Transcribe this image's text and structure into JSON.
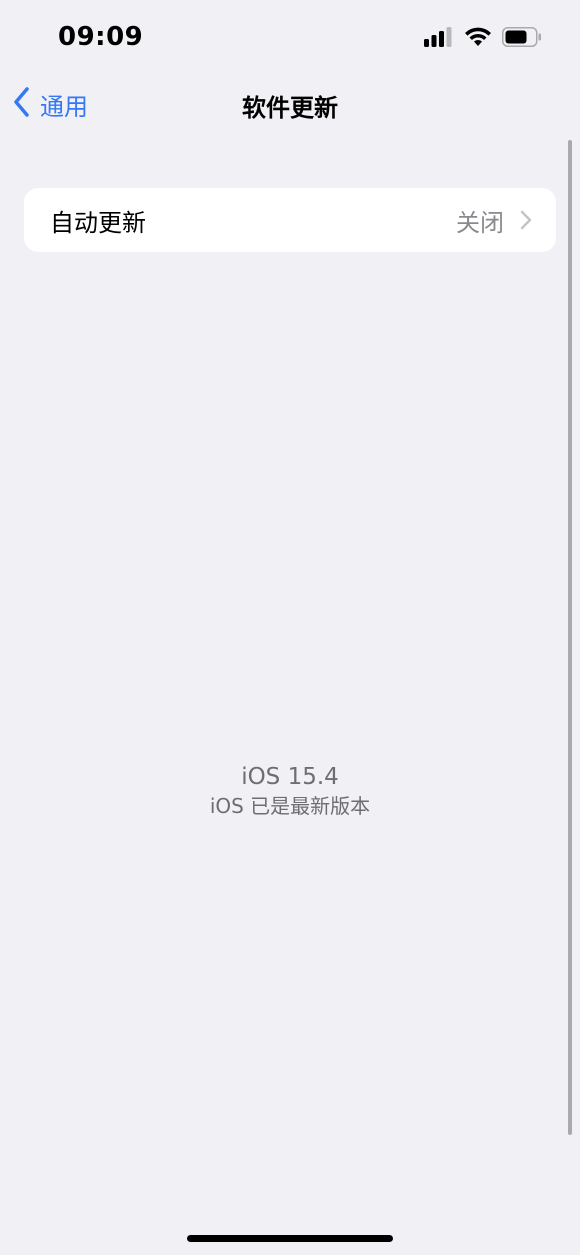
{
  "status_bar": {
    "time": "09:09"
  },
  "nav": {
    "back_label": "通用",
    "title": "软件更新"
  },
  "settings": {
    "auto_update": {
      "label": "自动更新",
      "value": "关闭"
    }
  },
  "version": {
    "name": "iOS 15.4",
    "status": "iOS 已是最新版本"
  },
  "colors": {
    "accent": "#3478f6",
    "background": "#f0f0f5",
    "secondary_text": "#8a8a8e"
  },
  "icons": {
    "signal": "cellular-signal-icon",
    "wifi": "wifi-icon",
    "battery": "battery-icon",
    "back": "chevron-left-icon",
    "disclosure": "chevron-right-icon"
  }
}
